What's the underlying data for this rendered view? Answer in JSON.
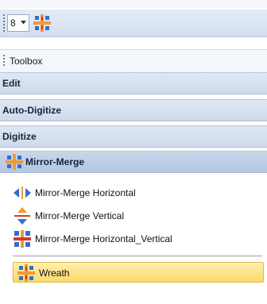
{
  "toolbar": {
    "size_value": "8"
  },
  "toolbox": {
    "label": "Toolbox"
  },
  "sections": [
    {
      "label": "Edit"
    },
    {
      "label": "Auto-Digitize"
    },
    {
      "label": "Digitize"
    },
    {
      "label": "Mirror-Merge"
    }
  ],
  "mirror_merge_items": [
    {
      "label": "Mirror-Merge Horizontal",
      "icon": "mirror-horizontal-icon"
    },
    {
      "label": "Mirror-Merge Vertical",
      "icon": "mirror-vertical-icon"
    },
    {
      "label": "Mirror-Merge Horizontal_Vertical",
      "icon": "mirror-horizontal-vertical-icon"
    },
    {
      "label": "Wreath",
      "icon": "wreath-icon",
      "selected": true
    }
  ],
  "colors": {
    "accent_orange": "#f29a2e",
    "accent_blue": "#2f6fd0",
    "selection": "#fbd96a"
  }
}
